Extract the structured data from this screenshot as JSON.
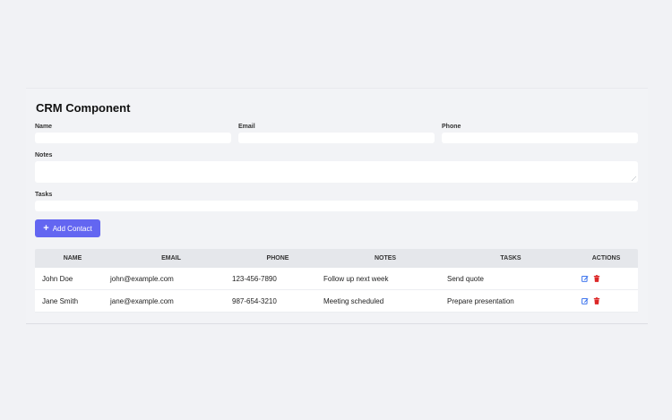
{
  "title": "CRM Component",
  "form": {
    "name_label": "Name",
    "email_label": "Email",
    "phone_label": "Phone",
    "notes_label": "Notes",
    "tasks_label": "Tasks",
    "name_value": "",
    "email_value": "",
    "phone_value": "",
    "tasks_value": ""
  },
  "add_button": {
    "icon": "plus-icon",
    "label": "Add Contact"
  },
  "table": {
    "headers": [
      "NAME",
      "EMAIL",
      "PHONE",
      "NOTES",
      "TASKS",
      "ACTIONS"
    ],
    "rows": [
      {
        "name": "John Doe",
        "email": "john@example.com",
        "phone": "123-456-7890",
        "notes": "Follow up next week",
        "tasks": "Send quote"
      },
      {
        "name": "Jane Smith",
        "email": "jane@example.com",
        "phone": "987-654-3210",
        "notes": "Meeting scheduled",
        "tasks": "Prepare presentation"
      }
    ],
    "action_icons": [
      "edit-icon",
      "trash-icon"
    ]
  },
  "colors": {
    "accent": "#6366f1",
    "edit": "#2563eb",
    "delete": "#dc2626"
  }
}
